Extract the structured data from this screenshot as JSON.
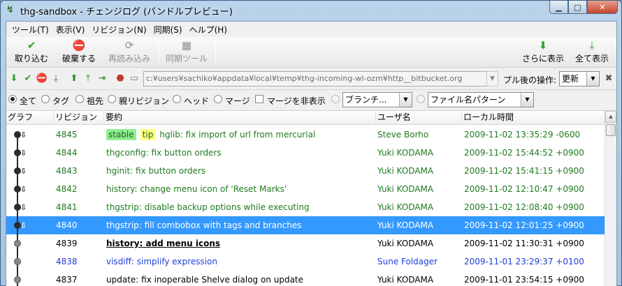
{
  "window": {
    "title": "thg-sandbox - チェンジログ (バンドルプレビュー)",
    "controls": [
      "minimize",
      "maximize",
      "close"
    ]
  },
  "menu": [
    "ツール(T)",
    "表示(V)",
    "リビジョン(N)",
    "同期(S)",
    "ヘルプ(H)"
  ],
  "toolbar1": {
    "accept": "取り込む",
    "reject": "破棄する",
    "reload": "再読み込み",
    "sync": "同期ツール",
    "show_more": "さらに表示",
    "show_all": "全て表示"
  },
  "toolbar2": {
    "url": "c:¥users¥sachiko¥appdata¥local¥temp¥thg-incoming-wl-ozm¥http__bitbucket.org",
    "after_pull_label": "プル後の操作:",
    "after_pull_value": "更新"
  },
  "filter": {
    "all": "全て",
    "tags": "タグ",
    "ancestors": "祖先",
    "parents": "親リビジョン",
    "heads": "ヘッド",
    "merges": "マージ",
    "hide_merges": "マージを非表示",
    "branch": "ブランチ...",
    "file_pattern": "ファイル名パターン"
  },
  "columns": {
    "graph": "グラフ",
    "rev": "リビジョン",
    "summary": "要約",
    "user": "ユーザ名",
    "time": "ローカル時間"
  },
  "rows": [
    {
      "rev": "4845",
      "tags": [
        "stable",
        "tip"
      ],
      "summary": "hglib: fix import of url from mercurial",
      "user": "Steve Borho",
      "time": "2009-11-02 13:35:29 -0600"
    },
    {
      "rev": "4844",
      "tags": [],
      "summary": "thgconfig: fix button orders",
      "user": "Yuki KODAMA",
      "time": "2009-11-02 15:44:52 +0900"
    },
    {
      "rev": "4843",
      "tags": [],
      "summary": "hginit: fix button orders",
      "user": "Yuki KODAMA",
      "time": "2009-11-02 15:41:15 +0900"
    },
    {
      "rev": "4842",
      "tags": [],
      "summary": "history: change menu icon of 'Reset Marks'",
      "user": "Yuki KODAMA",
      "time": "2009-11-02 12:10:47 +0900"
    },
    {
      "rev": "4841",
      "tags": [],
      "summary": "thgstrip: disable backup options while executing",
      "user": "Yuki KODAMA",
      "time": "2009-11-02 12:08:40 +0900"
    },
    {
      "rev": "4840",
      "tags": [],
      "summary": "thgstrip: fill combobox with tags and branches",
      "user": "Yuki KODAMA",
      "time": "2009-11-02 12:01:25 +0900"
    },
    {
      "rev": "4839",
      "tags": [],
      "summary": "history: add menu icons",
      "user": "Yuki KODAMA",
      "time": "2009-11-02 11:30:31 +0900"
    },
    {
      "rev": "4838",
      "tags": [],
      "summary": "visdiff: simplify expression",
      "user": "Sune Foldager",
      "time": "2009-11-01 23:29:37 +0100"
    },
    {
      "rev": "4837",
      "tags": [],
      "summary": "update: fix inoperable Shelve dialog on update",
      "user": "Yuki KODAMA",
      "time": "2009-11-01 23:54:15 +0900"
    }
  ],
  "colors": {
    "incoming": "#1f7a1f",
    "working_parent": "#000000",
    "other": "#1f3fd6",
    "selected": "#3399ff"
  }
}
